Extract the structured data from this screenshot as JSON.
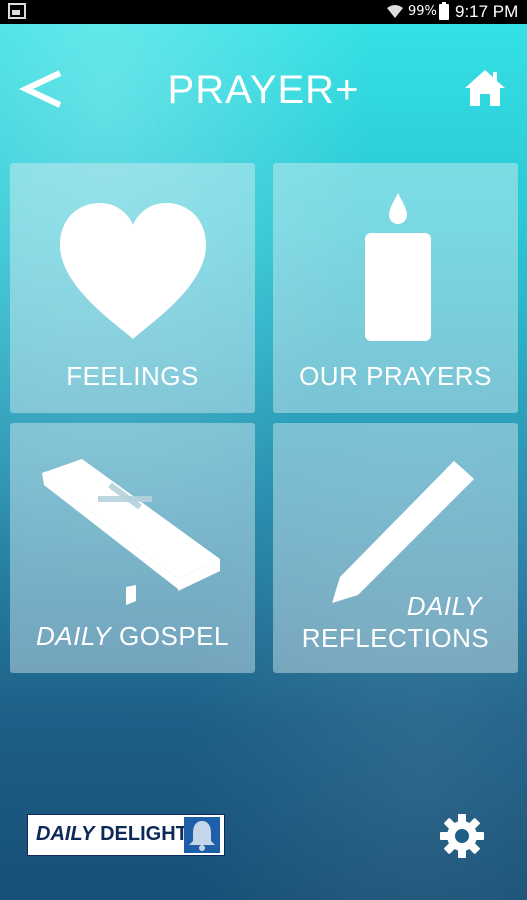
{
  "status_bar": {
    "battery": "99%",
    "time": "9:17 PM"
  },
  "header": {
    "title": "PRAYER+"
  },
  "tiles": [
    {
      "label": "FEELINGS",
      "icon": "heart-icon"
    },
    {
      "label": "OUR PRAYERS",
      "icon": "candle-icon"
    },
    {
      "label_italic": "DAILY",
      "label": "GOSPEL",
      "icon": "bible-icon"
    },
    {
      "label_italic": "DAILY",
      "label": "REFLECTIONS",
      "icon": "pencil-icon"
    }
  ],
  "footer": {
    "logo_italic": "DAILY",
    "logo_text": "DELIGHTS"
  },
  "colors": {
    "accent_top": "#35e4e6",
    "accent_bottom": "#174f76",
    "logo_navy": "#0b2a5a"
  }
}
